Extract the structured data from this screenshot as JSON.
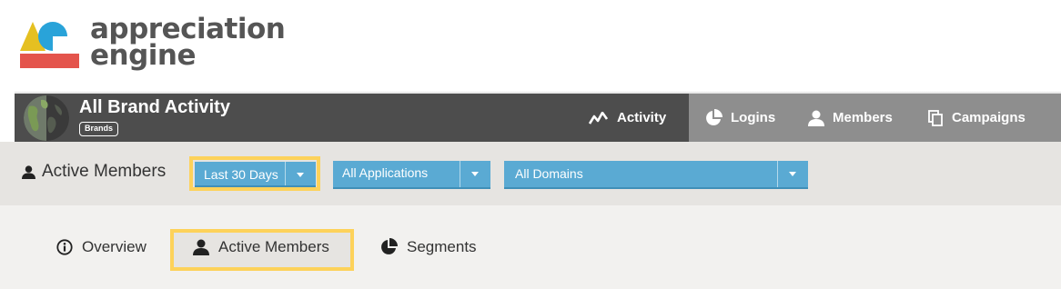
{
  "logo": {
    "line1": "appreciation",
    "line2": "engine",
    "colors": {
      "yellow": "#e5c021",
      "blue": "#29a3d9",
      "red": "#e4544c"
    }
  },
  "header": {
    "title": "All Brand Activity",
    "badge": "Brands",
    "nav": [
      {
        "label": "Activity",
        "icon": "activity-icon",
        "active": true
      },
      {
        "label": "Logins",
        "icon": "pie-chart-icon",
        "active": false
      },
      {
        "label": "Members",
        "icon": "user-icon",
        "active": false
      },
      {
        "label": "Campaigns",
        "icon": "copy-icon",
        "active": false
      }
    ]
  },
  "filters": {
    "title": "Active Members",
    "date_range": "Last 30 Days",
    "applications": "All Applications",
    "domains": "All Domains"
  },
  "tabs": [
    {
      "label": "Overview",
      "icon": "info-icon",
      "active": false
    },
    {
      "label": "Active Members",
      "icon": "user-icon",
      "active": true
    },
    {
      "label": "Segments",
      "icon": "pie-chart-icon",
      "active": false
    }
  ],
  "colors": {
    "header_dark": "#4d4d4d",
    "header_gray": "#8e8e8e",
    "dropdown_blue": "#5aaad3",
    "highlight_yellow": "#fdd25a"
  }
}
